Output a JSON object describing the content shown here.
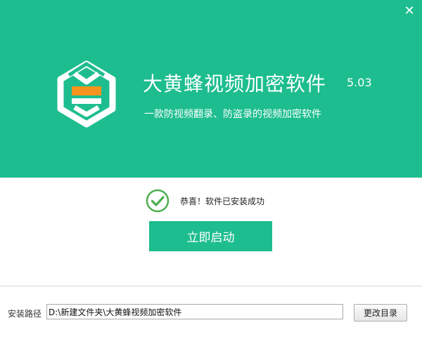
{
  "window": {
    "close_icon": "close-icon",
    "close_glyph": "✕"
  },
  "header": {
    "background_color": "#1dbd8f",
    "logo_icon": "shield-hexagon-logo",
    "title": "大黄蜂视频加密软件",
    "version": "5.03",
    "subtitle": "一款防视频翻录、防盗录的视频加密软件"
  },
  "status": {
    "icon": "check-circle-icon",
    "icon_color": "#4caf50",
    "message": "恭喜！软件已安装成功"
  },
  "actions": {
    "launch_label": "立即启动",
    "launch_color": "#1dbd8f"
  },
  "install": {
    "path_label": "安装路径",
    "path_value": "D:\\新建文件夹\\大黄蜂视频加密软件",
    "change_dir_label": "更改目录"
  }
}
